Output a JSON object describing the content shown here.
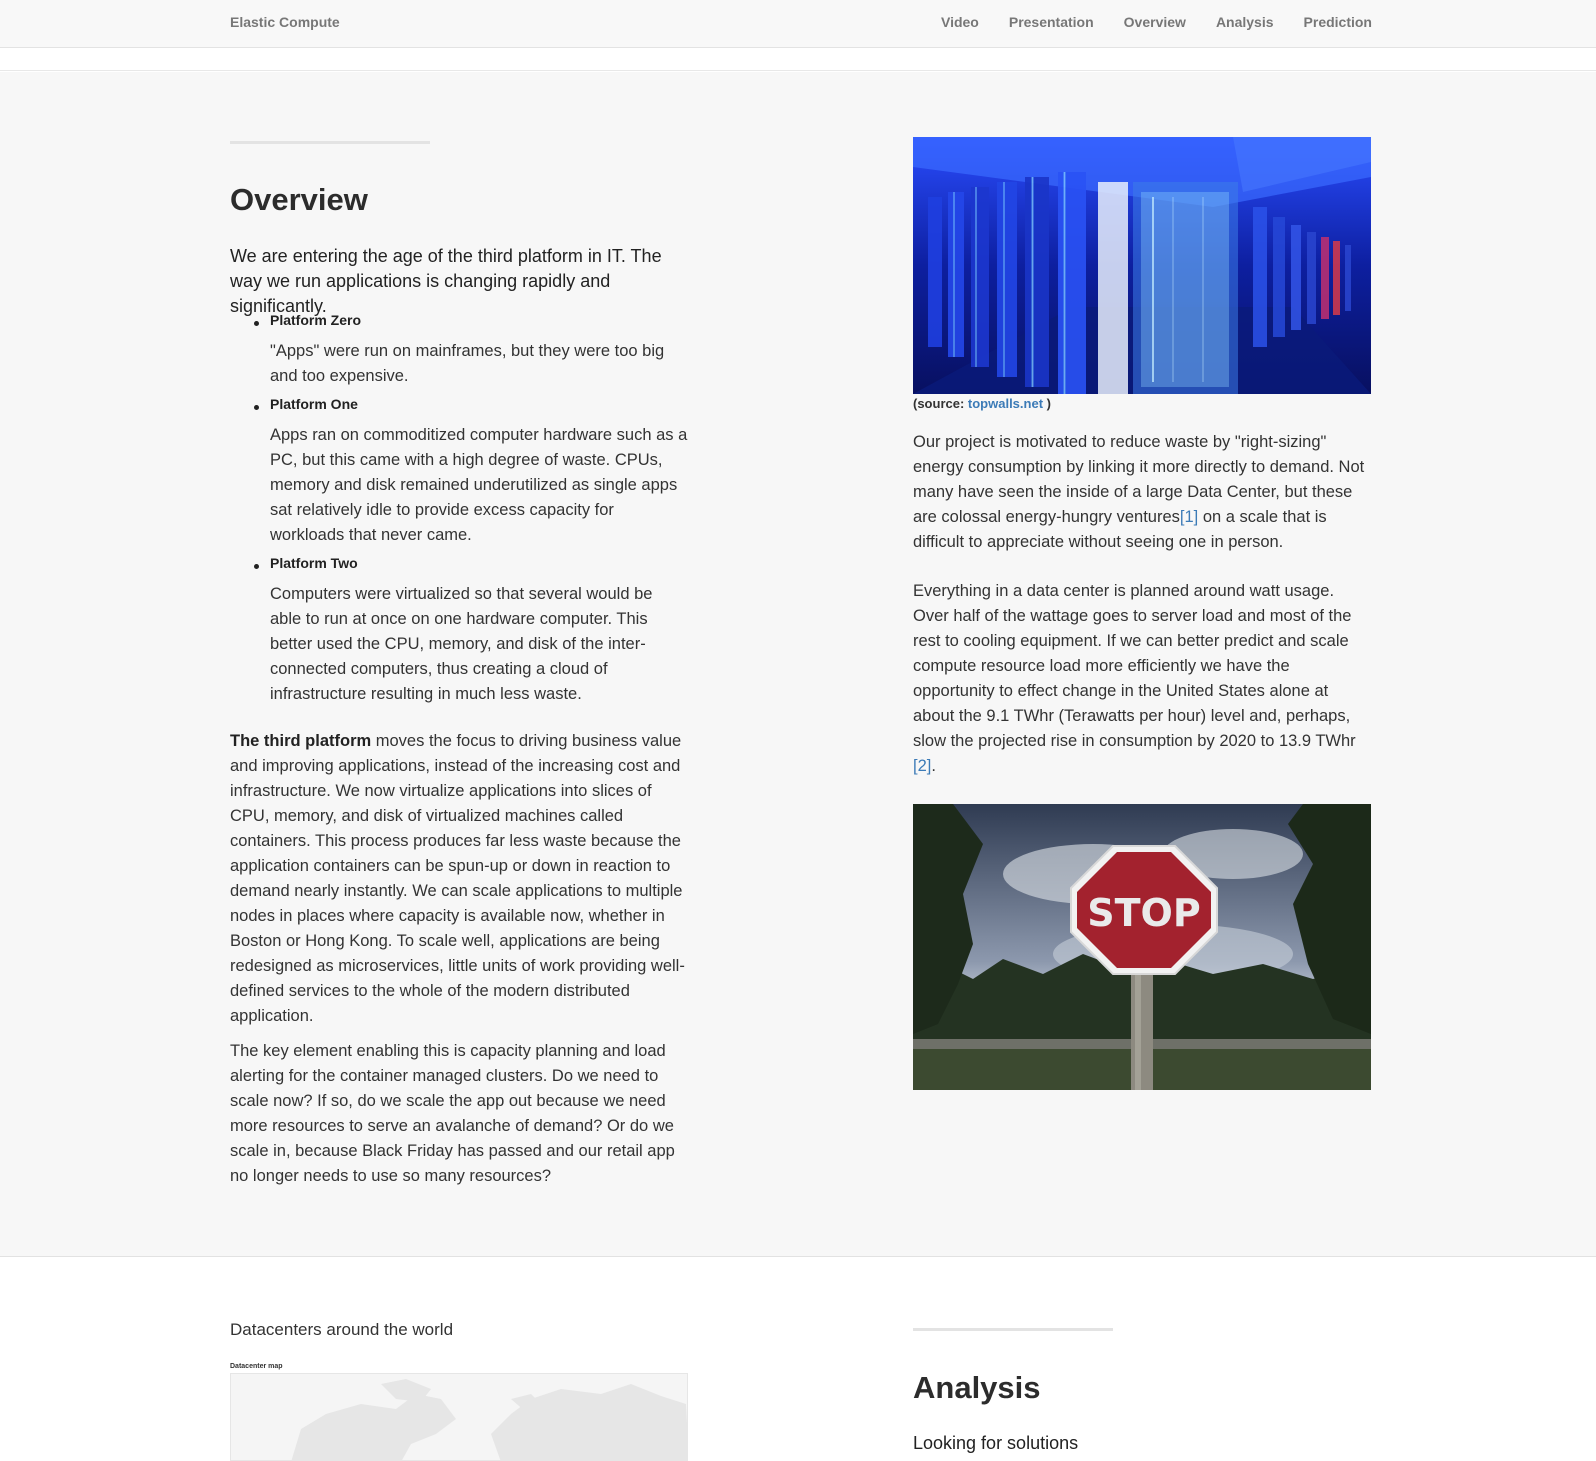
{
  "navbar": {
    "brand": "Elastic Compute",
    "links": [
      "Video",
      "Presentation",
      "Overview",
      "Analysis",
      "Prediction"
    ]
  },
  "overview": {
    "title": "Overview",
    "lead": "We are entering the age of the third platform in IT. The way we run applications is changing rapidly and significantly.",
    "platforms": [
      {
        "name": "Platform Zero",
        "text": "\"Apps\" were run on mainframes, but they were too big and too expensive."
      },
      {
        "name": "Platform One",
        "text": "Apps ran on commoditized computer hardware such as a PC, but this came with a high degree of waste. CPUs, memory and disk remained underutilized as single apps sat relatively idle to provide excess capacity for workloads that never came."
      },
      {
        "name": "Platform Two",
        "text": "Computers were virtualized so that several would be able to run at once on one hardware computer. This better used the CPU, memory, and disk of the inter-connected computers, thus creating a cloud of infrastructure resulting in much less waste."
      }
    ],
    "third_platform_bold": "The third platform",
    "third_platform_text": " moves the focus to driving business value and improving applications, instead of the increasing cost and infrastructure. We now virtualize applications into slices of CPU, memory, and disk of virtualized machines called containers. This process produces far less waste because the application containers can be spun-up or down in reaction to demand nearly instantly. We can scale applications to multiple nodes in places where capacity is available now, whether in Boston or Hong Kong. To scale well, applications are being redesigned as microservices, little units of work providing well-defined services to the whole of the modern distributed application.",
    "key_element": "The key element enabling this is capacity planning and load alerting for the container managed clusters. Do we need to scale now? If so, do we scale the app out because we need more resources to serve an avalanche of demand? Or do we scale in, because Black Friday has passed and our retail app no longer needs to use so many resources?"
  },
  "right": {
    "caption_prefix": "(source: ",
    "caption_link": "topwalls.net",
    "caption_suffix": " )",
    "para1_a": "Our project is motivated to reduce waste by \"right-sizing\" energy consumption by linking it more directly to demand. Not many have seen the inside of a large Data Center, but these are colossal energy-hungry ventures",
    "ref1": "[1]",
    "para1_b": " on a scale that is difficult to appreciate without seeing one in person.",
    "para2_a": "Everything in a data center is planned around watt usage. Over half of the wattage goes to server load and most of the rest to cooling equipment. If we can better predict and scale compute resource load more efficiently we have the opportunity to effect change in the United States alone at about the 9.1 TWhr (Terawatts per hour) level and, perhaps, slow the projected rise in consumption by 2020 to 13.9 TWhr ",
    "ref2": "[2]",
    "para2_b": ".",
    "stop_sign_text": "STOP"
  },
  "bottom": {
    "map_title": "Datacenters around the world",
    "map_label": "Datacenter map",
    "analysis_title": "Analysis",
    "analysis_sub": "Looking for solutions"
  },
  "colors": {
    "link": "#3c7bb7",
    "nav_text": "#777777",
    "section_bg": "#f7f7f7",
    "datacenter_blue": "#1b3cff"
  }
}
